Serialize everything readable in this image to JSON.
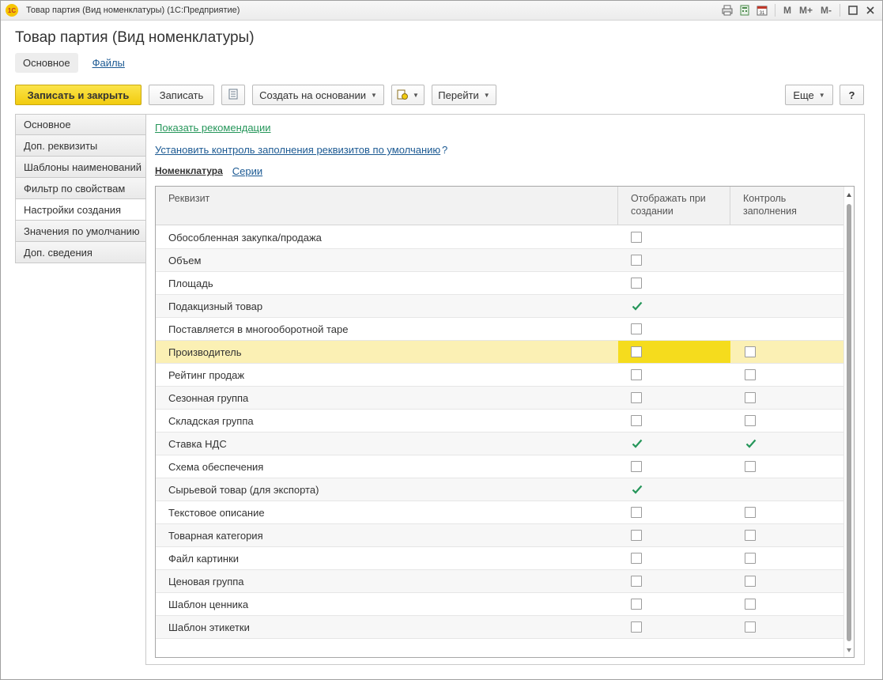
{
  "window": {
    "title": "Товар партия (Вид номенклатуры)  (1С:Предприятие)",
    "logo_text": "1С",
    "tools": [
      "printer-icon",
      "calculator-icon",
      "calendar-icon"
    ],
    "memory_buttons": [
      "M",
      "M+",
      "M-"
    ]
  },
  "page_title": "Товар партия (Вид номенклатуры)",
  "topnav": {
    "main": "Основное",
    "files": "Файлы"
  },
  "toolbar": {
    "save_close": "Записать и закрыть",
    "save": "Записать",
    "create_based": "Создать на основании",
    "go_to": "Перейти",
    "more": "Еще",
    "help": "?"
  },
  "lefttabs": [
    "Основное",
    "Доп. реквизиты",
    "Шаблоны наименований",
    "Фильтр по свойствам",
    "Настройки создания",
    "Значения по умолчанию",
    "Доп. сведения"
  ],
  "links": {
    "show_recommendations": "Показать рекомендации",
    "set_control": "Установить контроль заполнения реквизитов по умолчанию",
    "question": "?"
  },
  "subtabs": {
    "nomenclature": "Номенклатура",
    "series": "Серии"
  },
  "grid": {
    "headers": [
      "Реквизит",
      "Отображать при\nсоздании",
      "Контроль\nзаполнения"
    ],
    "rows": [
      {
        "name": "Обособленная закупка/продажа",
        "show": "unchecked",
        "control": "none"
      },
      {
        "name": "Объем",
        "show": "unchecked",
        "control": "none"
      },
      {
        "name": "Площадь",
        "show": "unchecked",
        "control": "none"
      },
      {
        "name": "Подакцизный товар",
        "show": "checked",
        "control": "none"
      },
      {
        "name": "Поставляется в многооборотной таре",
        "show": "unchecked",
        "control": "none"
      },
      {
        "name": "Производитель",
        "show": "unchecked",
        "control": "unchecked",
        "selected": true
      },
      {
        "name": "Рейтинг продаж",
        "show": "unchecked",
        "control": "unchecked"
      },
      {
        "name": "Сезонная группа",
        "show": "unchecked",
        "control": "unchecked"
      },
      {
        "name": "Складская группа",
        "show": "unchecked",
        "control": "unchecked"
      },
      {
        "name": "Ставка НДС",
        "show": "checked",
        "control": "checked"
      },
      {
        "name": "Схема обеспечения",
        "show": "unchecked",
        "control": "unchecked"
      },
      {
        "name": "Сырьевой товар (для экспорта)",
        "show": "checked",
        "control": "none"
      },
      {
        "name": "Текстовое описание",
        "show": "unchecked",
        "control": "unchecked"
      },
      {
        "name": "Товарная категория",
        "show": "unchecked",
        "control": "unchecked"
      },
      {
        "name": "Файл картинки",
        "show": "unchecked",
        "control": "unchecked"
      },
      {
        "name": "Ценовая группа",
        "show": "unchecked",
        "control": "unchecked"
      },
      {
        "name": "Шаблон ценника",
        "show": "unchecked",
        "control": "unchecked"
      },
      {
        "name": "Шаблон этикетки",
        "show": "unchecked",
        "control": "unchecked"
      }
    ]
  },
  "colors": {
    "accent_yellow": "#f2cc0f",
    "check_green": "#25965a",
    "link_blue": "#1c5a93",
    "selected_row": "#fbf0b4"
  }
}
